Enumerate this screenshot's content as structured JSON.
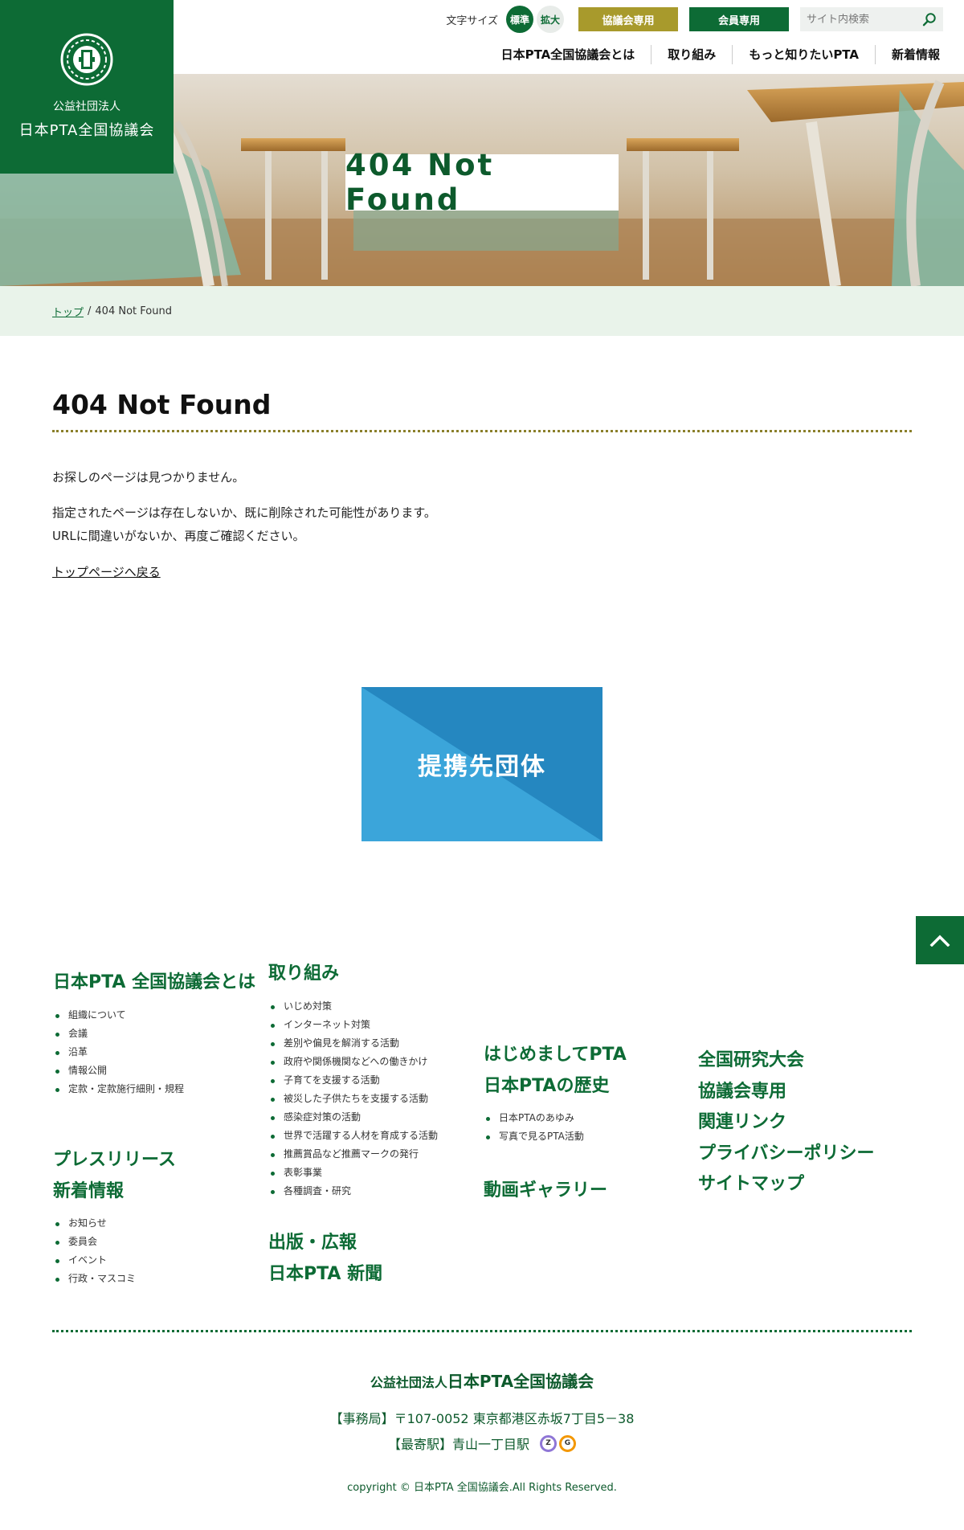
{
  "header": {
    "org_type": "公益社団法人",
    "org_name": "日本PTA全国協議会",
    "font_size_label": "文字サイズ",
    "font_size_standard": "標準",
    "font_size_large": "拡大",
    "council_only_label": "協議会専用",
    "members_only_label": "会員専用",
    "search_placeholder": "サイト内検索"
  },
  "nav": {
    "items": [
      {
        "label": "日本PTA全国協議会とは"
      },
      {
        "label": "取り組み"
      },
      {
        "label": "もっと知りたいPTA"
      },
      {
        "label": "新着情報"
      }
    ]
  },
  "hero": {
    "title": "404 Not Found"
  },
  "breadcrumb": {
    "home": "トップ",
    "separator": "/",
    "current": "404 Not Found"
  },
  "content": {
    "heading": "404 Not Found",
    "para1": "お探しのページは見つかりません。",
    "para2_line1": "指定されたページは存在しないか、既に削除された可能性があります。",
    "para2_line2": "URLに間違いがないか、再度ご確認ください。",
    "back_link": "トップページへ戻る"
  },
  "banner": {
    "label": "提携先団体"
  },
  "footer": {
    "col1": {
      "about": {
        "heading": "日本PTA 全国協議会とは",
        "items": [
          "組織について",
          "会議",
          "沿革",
          "情報公開",
          "定款・定款施行細則・規程"
        ]
      },
      "press": {
        "heading": "プレスリリース"
      },
      "news": {
        "heading": "新着情報",
        "items": [
          "お知らせ",
          "委員会",
          "イベント",
          "行政・マスコミ"
        ]
      }
    },
    "col2": {
      "activities": {
        "heading": "取り組み",
        "items": [
          "いじめ対策",
          "インターネット対策",
          "差別や偏見を解消する活動",
          "政府や関係機関などへの働きかけ",
          "子育てを支援する活動",
          "被災した子供たちを支援する活動",
          "感染症対策の活動",
          "世界で活躍する人材を育成する活動",
          "推薦賞品など推薦マークの発行",
          "表彰事業",
          "各種調査・研究"
        ]
      },
      "publishing": {
        "heading": "出版・広報"
      },
      "newspaper": {
        "heading": "日本PTA 新聞"
      }
    },
    "col3": {
      "intro": {
        "heading": "はじめましてPTA"
      },
      "history": {
        "heading": "日本PTAの歴史",
        "items": [
          "日本PTAのあゆみ",
          "写真で見るPTA活動"
        ]
      },
      "video": {
        "heading": "動画ギャラリー"
      }
    },
    "col4": {
      "links": [
        {
          "label": "全国研究大会"
        },
        {
          "label": "協議会専用"
        },
        {
          "label": "関連リンク"
        },
        {
          "label": "プライバシーポリシー"
        },
        {
          "label": "サイトマップ"
        }
      ]
    },
    "org_type": "公益社団法人",
    "org_name": "日本PTA全国協議会",
    "address": "【事務局】〒107-0052 東京都港区赤坂7丁目5－38",
    "station": "【最寄駅】青山一丁目駅",
    "lines": [
      {
        "letter": "Z",
        "color": "#8f76d6"
      },
      {
        "letter": "G",
        "color": "#f39700"
      }
    ],
    "copyright": "copyright © 日本PTA 全国協議会.All Rights Reserved."
  },
  "colors": {
    "brand_green": "#0d6b35",
    "gold": "#a89a2c",
    "banner_blue": "#2f97cf"
  }
}
